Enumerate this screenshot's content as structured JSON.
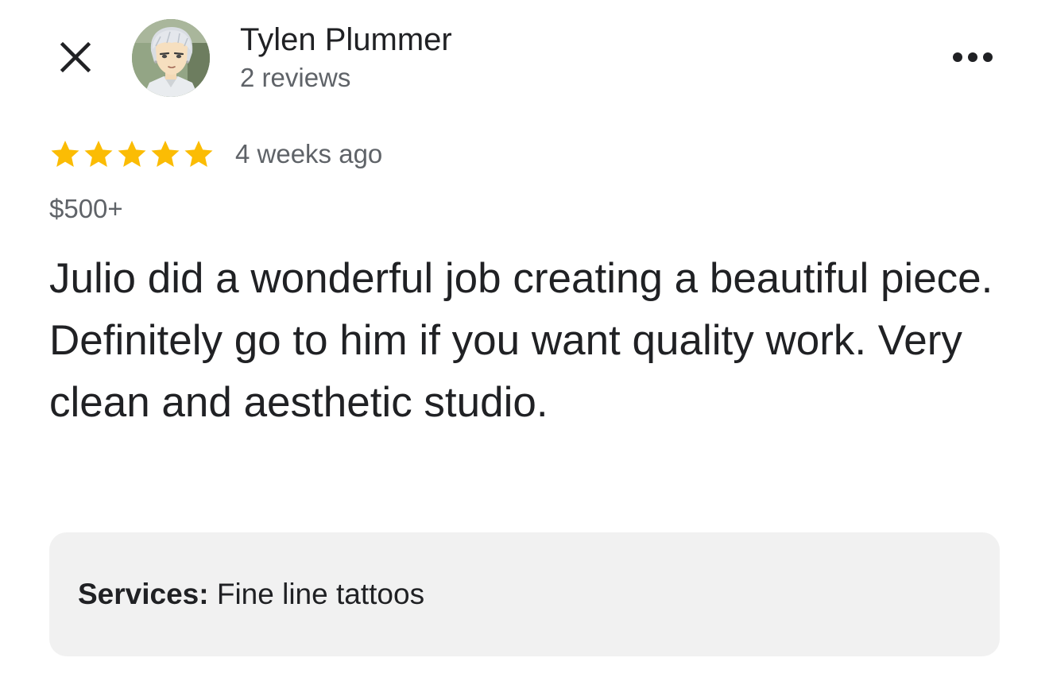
{
  "header": {
    "close_icon": "close-icon",
    "author_name": "Tylen Plummer",
    "review_count": "2 reviews",
    "more_icon": "more-horizontal-icon"
  },
  "review": {
    "rating": 5,
    "rating_max": 5,
    "star_color": "#fbbc04",
    "time": "4 weeks ago",
    "price": "$500+",
    "text": "Julio did a wonderful job creating a beautiful piece. Definitely go to him if you want quality work. Very clean and aesthetic studio."
  },
  "services": {
    "label": "Services:",
    "value": "Fine line tattoos"
  }
}
